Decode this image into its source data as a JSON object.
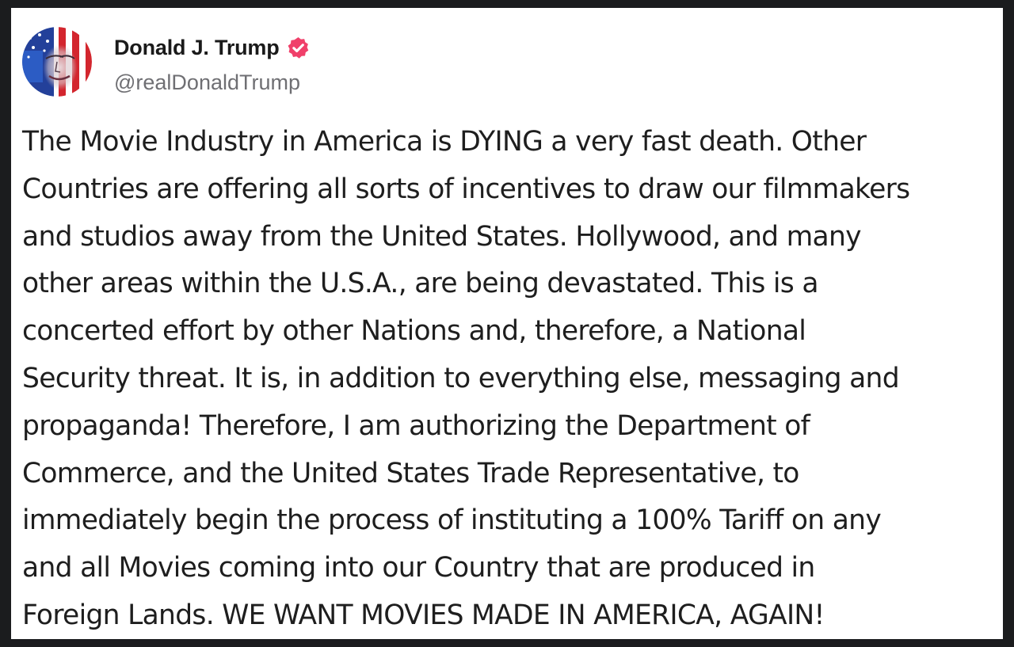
{
  "post": {
    "author": {
      "display_name": "Donald J. Trump",
      "handle": "@realDonaldTrump",
      "verified": true,
      "avatar_icon": "profile-avatar-flag-portrait"
    },
    "body_lines": [
      "The Movie Industry in America is DYING a very fast death. Other",
      "Countries are offering all sorts of incentives to draw our filmmakers",
      "and studios away from the United States. Hollywood, and many",
      "other areas within the U.S.A., are being devastated. This is a",
      "concerted effort by other Nations and, therefore, a National",
      "Security threat. It is, in addition to everything else, messaging and",
      "propaganda! Therefore, I am authorizing the Department of",
      "Commerce, and the United States Trade Representative, to",
      "immediately begin the process of instituting a 100% Tariff on any",
      "and all Movies coming into our Country that are produced in",
      "Foreign Lands. WE WANT MOVIES MADE IN AMERICA, AGAIN!"
    ]
  },
  "colors": {
    "background": "#1b1c1e",
    "card": "#ffffff",
    "text": "#1e1e1e",
    "handle": "#6f6f73",
    "verified_badge": "#f0406a"
  }
}
